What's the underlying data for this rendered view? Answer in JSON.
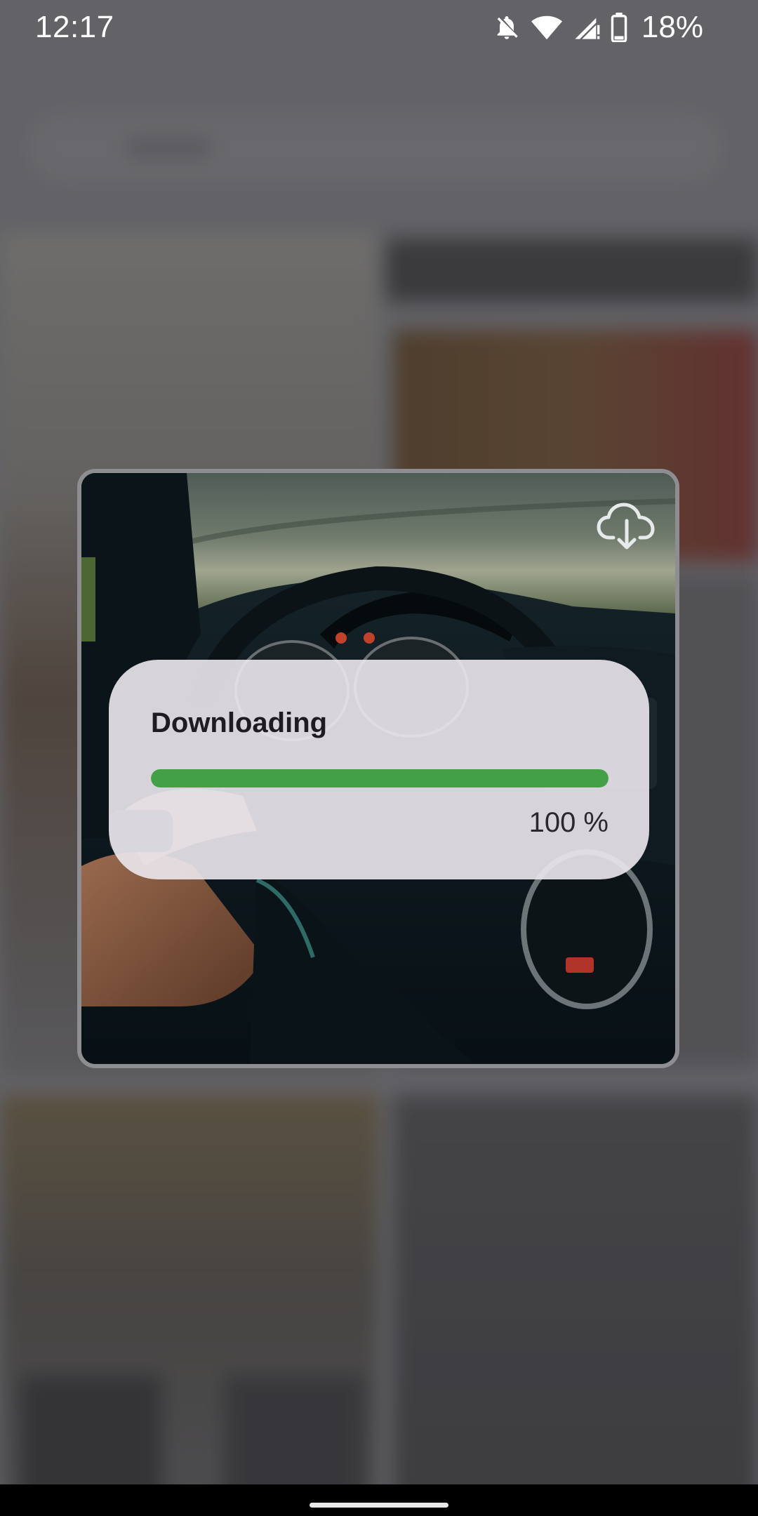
{
  "status_bar": {
    "time": "12:17",
    "battery_percent": "18%",
    "icons": [
      "notifications-off-icon",
      "wifi-icon",
      "cell-signal-icon",
      "battery-icon"
    ]
  },
  "preview": {
    "action_icon": "cloud-download-icon"
  },
  "download_dialog": {
    "title": "Downloading",
    "progress_value": 100,
    "progress_text": "100 %",
    "accent_color": "#43a047"
  },
  "navigation": {
    "home_handle": "home-handle"
  }
}
